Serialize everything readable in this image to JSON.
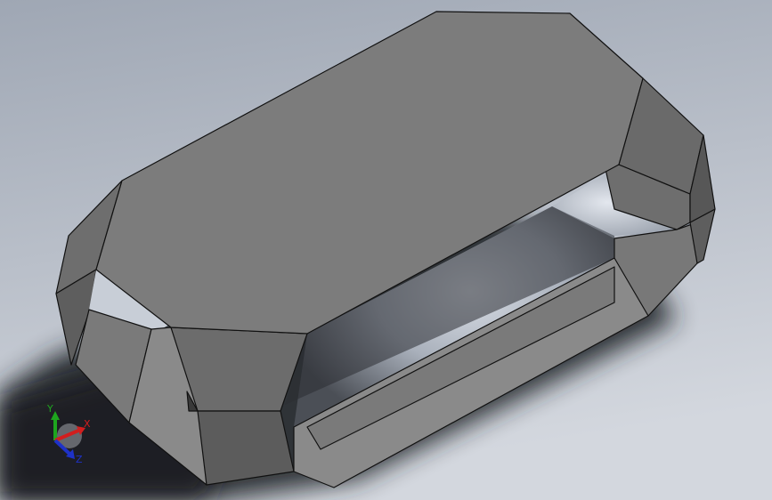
{
  "view": {
    "background_top": "#9fa7b4",
    "background_bottom": "#d3d7de",
    "shadow_color": "#26282c",
    "part_face_color": "#7c7c7c",
    "part_edge_color": "#111111"
  },
  "triad": {
    "x_label": "X",
    "y_label": "Y",
    "z_label": "Z",
    "x_color": "#d21e1e",
    "y_color": "#1ea51e",
    "z_color": "#1e32c8"
  }
}
